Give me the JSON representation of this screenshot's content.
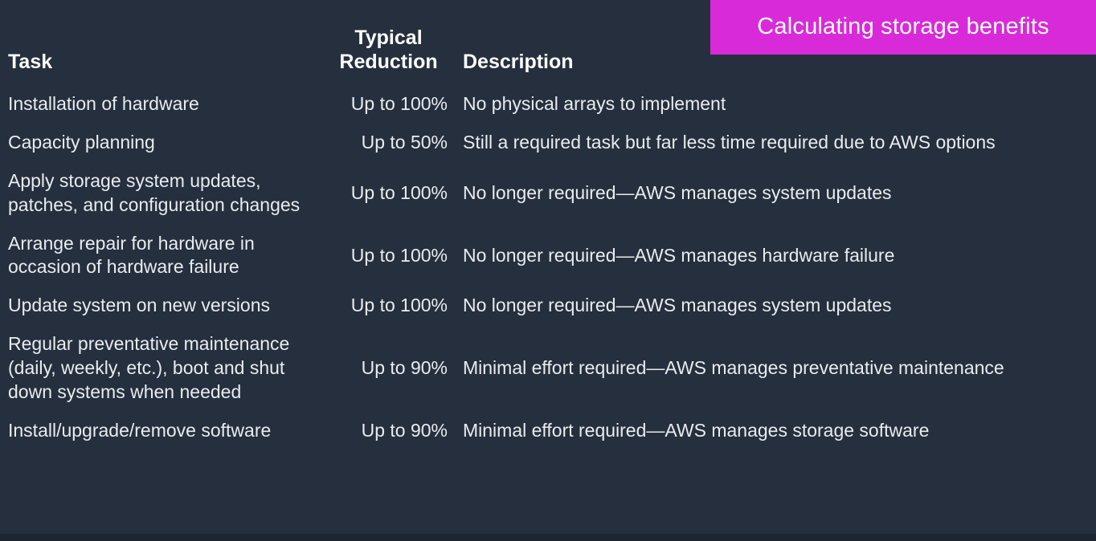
{
  "banner": {
    "title": "Calculating storage benefits",
    "background_color": "#d92ad9",
    "text_color": "#ffffff"
  },
  "slide": {
    "background_color": "#252f3e",
    "text_color": "#e9ecef"
  },
  "table": {
    "headers": {
      "task": "Task",
      "reduction": "Typical\nReduction",
      "reduction_line1": "Typical",
      "reduction_line2": "Reduction",
      "description": "Description"
    },
    "rows": [
      {
        "task": "Installation of hardware",
        "reduction": "Up to 100%",
        "description": "No physical arrays to implement"
      },
      {
        "task": "Capacity planning",
        "reduction": "Up to 50%",
        "description": "Still a required task but far less time required due to AWS options"
      },
      {
        "task": "Apply storage system updates, patches, and configuration changes",
        "reduction": "Up to 100%",
        "description": "No longer required—AWS manages system updates"
      },
      {
        "task": "Arrange repair for hardware in occasion of hardware failure",
        "reduction": "Up to 100%",
        "description": "No longer required—AWS manages hardware failure"
      },
      {
        "task": "Update system on new versions",
        "reduction": "Up to 100%",
        "description": "No longer required—AWS manages system updates"
      },
      {
        "task": "Regular preventative maintenance (daily, weekly, etc.), boot and shut down systems when needed",
        "reduction": "Up to 90%",
        "description": "Minimal effort required—AWS manages preventative maintenance"
      },
      {
        "task": "Install/upgrade/remove software",
        "reduction": "Up to 90%",
        "description": "Minimal effort required—AWS manages storage software"
      }
    ]
  }
}
